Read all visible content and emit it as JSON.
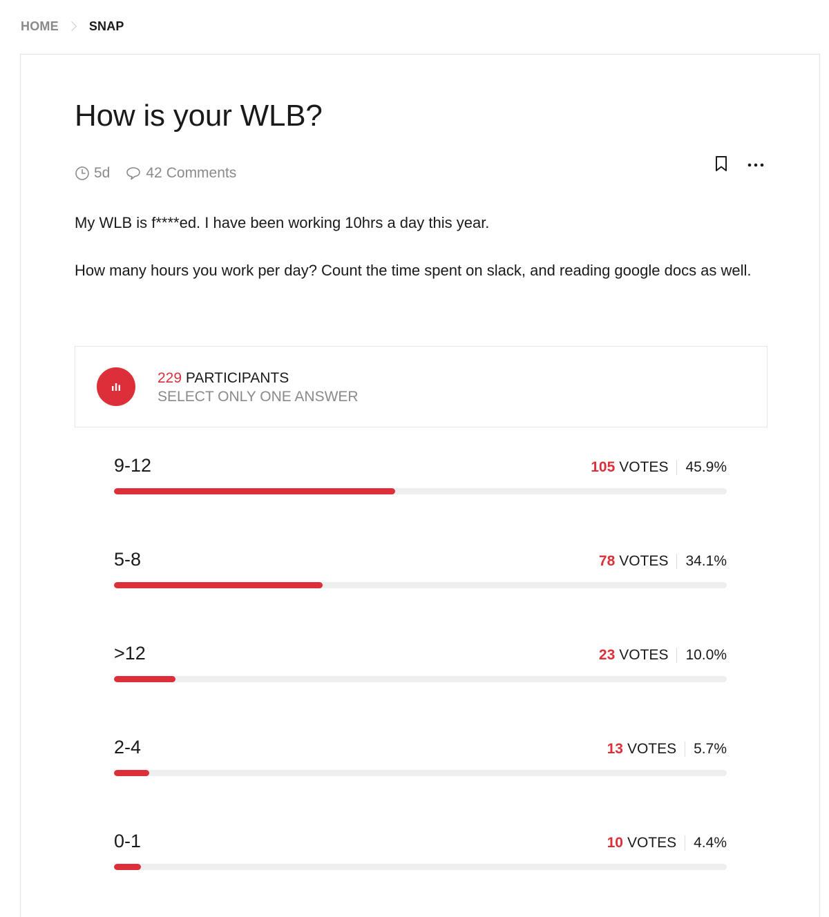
{
  "breadcrumb": {
    "home": "HOME",
    "current": "SNAP"
  },
  "post": {
    "title": "How is your WLB?",
    "time_ago": "5d",
    "comment_count": "42",
    "comments_label": "Comments",
    "paragraphs": [
      "My WLB is f****ed. I have been working 10hrs a day this year.",
      "How many hours you work per day? Count the time spent on slack, and reading google docs as well."
    ]
  },
  "actions": {
    "bookmark_icon": "bookmark-icon",
    "more_icon": "more-icon"
  },
  "poll": {
    "participants": "229",
    "participants_label": "PARTICIPANTS",
    "instruction": "SELECT ONLY ONE ANSWER",
    "votes_label": "VOTES",
    "accent_color": "#dc2f3a",
    "options": [
      {
        "label": "9-12",
        "votes": "105",
        "percent": "45.9%",
        "fraction": 0.459
      },
      {
        "label": "5-8",
        "votes": "78",
        "percent": "34.1%",
        "fraction": 0.341
      },
      {
        "label": ">12",
        "votes": "23",
        "percent": "10.0%",
        "fraction": 0.1
      },
      {
        "label": "2-4",
        "votes": "13",
        "percent": "5.7%",
        "fraction": 0.057
      },
      {
        "label": "0-1",
        "votes": "10",
        "percent": "4.4%",
        "fraction": 0.044
      }
    ]
  }
}
